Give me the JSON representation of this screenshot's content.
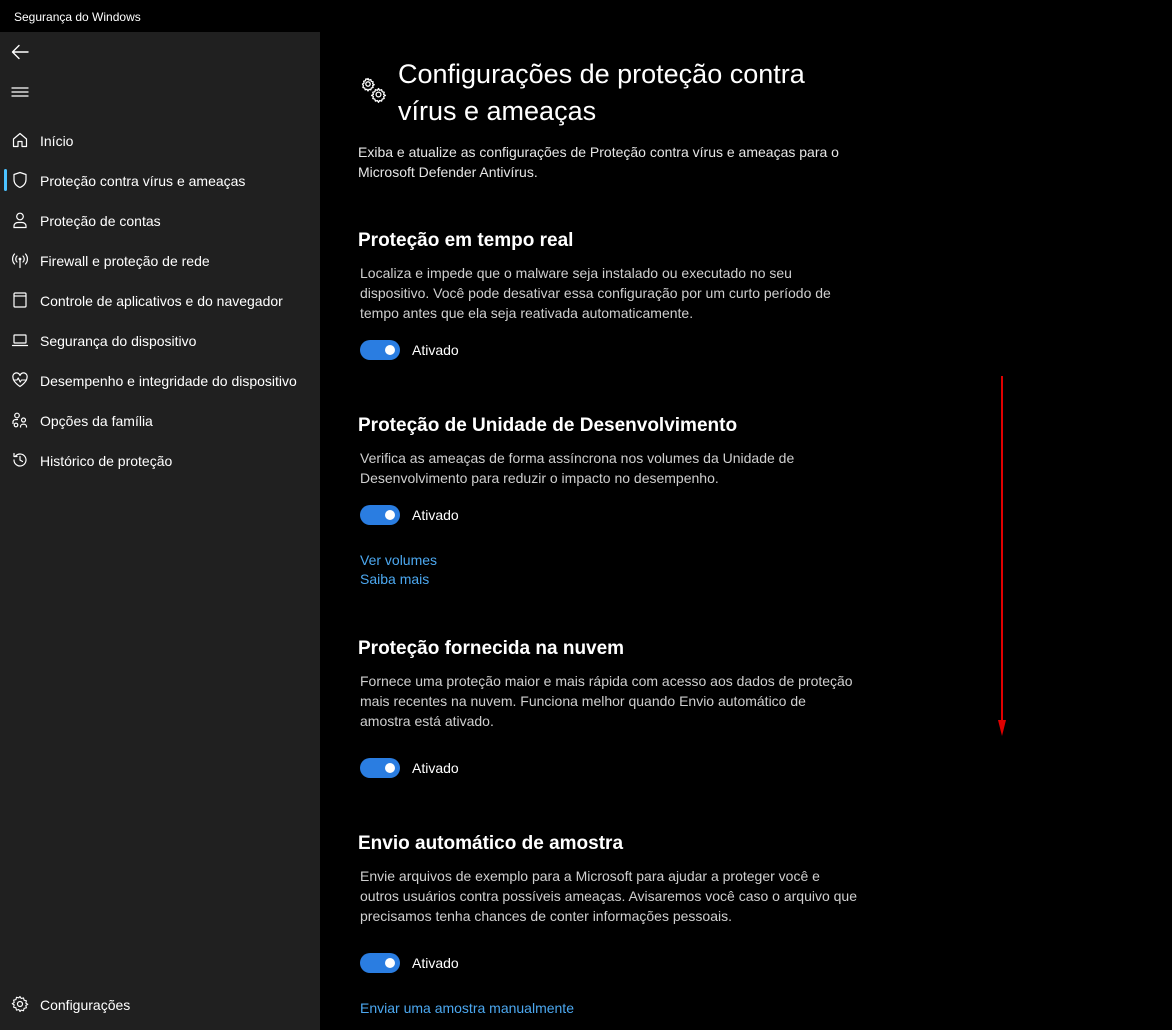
{
  "window": {
    "title": "Segurança do Windows"
  },
  "sidebar": {
    "items": [
      {
        "label": "Início",
        "icon": "home-icon"
      },
      {
        "label": "Proteção contra vírus e ameaças",
        "icon": "shield-icon",
        "active": true
      },
      {
        "label": "Proteção de contas",
        "icon": "person-icon"
      },
      {
        "label": "Firewall e proteção de rede",
        "icon": "wireless-antenna-icon"
      },
      {
        "label": "Controle de aplicativos e do navegador",
        "icon": "app-window-icon"
      },
      {
        "label": "Segurança do dispositivo",
        "icon": "laptop-icon"
      },
      {
        "label": "Desempenho e integridade do dispositivo",
        "icon": "heart-pulse-icon"
      },
      {
        "label": "Opções da família",
        "icon": "family-icon"
      },
      {
        "label": "Histórico de proteção",
        "icon": "history-icon"
      }
    ],
    "settings_label": "Configurações"
  },
  "page": {
    "title": "Configurações de proteção contra vírus e ameaças",
    "description": "Exiba e atualize as configurações de Proteção contra vírus e ameaças para o Microsoft Defender Antivírus."
  },
  "sections": [
    {
      "title": "Proteção em tempo real",
      "description": "Localiza e impede que o malware seja instalado ou executado no seu dispositivo. Você pode desativar essa configuração por um curto período de tempo antes que ela seja reativada automaticamente.",
      "toggle_label": "Ativado",
      "toggle_on": true
    },
    {
      "title": "Proteção de Unidade de Desenvolvimento",
      "description": "Verifica as ameaças de forma assíncrona nos volumes da Unidade de Desenvolvimento para reduzir o impacto no desempenho.",
      "toggle_label": "Ativado",
      "toggle_on": true,
      "links": [
        "Ver volumes",
        "Saiba mais"
      ]
    },
    {
      "title": "Proteção fornecida na nuvem",
      "description": "Fornece uma proteção maior e mais rápida com acesso aos dados de proteção mais recentes na nuvem. Funciona melhor quando Envio automático de amostra está ativado.",
      "toggle_label": "Ativado",
      "toggle_on": true
    },
    {
      "title": "Envio automático de amostra",
      "description": "Envie arquivos de exemplo para a Microsoft para ajudar a proteger você e outros usuários contra possíveis ameaças. Avisaremos você caso o arquivo que precisamos tenha chances de conter informações pessoais.",
      "toggle_label": "Ativado",
      "toggle_on": true,
      "links": [
        "Enviar uma amostra manualmente"
      ]
    }
  ],
  "colors": {
    "accent": "#2a7de1",
    "link": "#4ca8f0",
    "annotation_arrow": "#e00000"
  }
}
